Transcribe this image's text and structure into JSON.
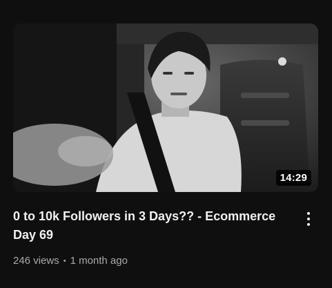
{
  "video": {
    "duration": "14:29",
    "title": "0 to 10k Followers in 3 Days?? - Ecommerce Day 69",
    "views": "246 views",
    "separator": "•",
    "age": "1 month ago",
    "menu_icon": "more-vertical-icon"
  },
  "colors": {
    "background": "#0f0f0f",
    "title": "#f1f1f1",
    "meta": "#aaaaaa",
    "badge_bg": "#000000"
  }
}
